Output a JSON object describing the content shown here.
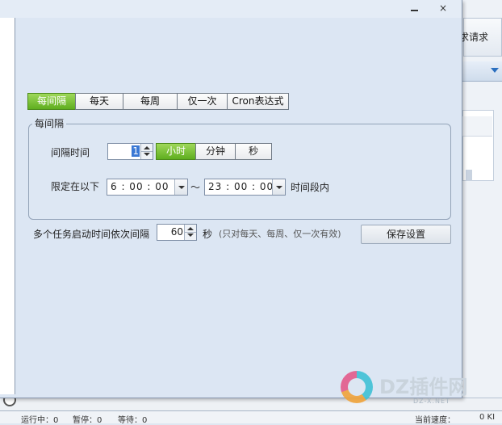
{
  "background": {
    "toolbar_button_label": "求请求",
    "status": {
      "running": "运行中：0",
      "paused": "暂停：0",
      "waiting": "等待：0",
      "speed": "当前速度：",
      "speed_value": "0 KI"
    }
  },
  "dialog": {
    "controls": {
      "minimize": "—",
      "close": "×"
    },
    "tabs": [
      {
        "label": "每间隔",
        "active": true
      },
      {
        "label": "每天",
        "active": false
      },
      {
        "label": "每周",
        "active": false
      },
      {
        "label": "仅一次",
        "active": false
      },
      {
        "label": "Cron表达式",
        "active": false
      }
    ],
    "group_title": "每间隔",
    "interval": {
      "label": "间隔时间",
      "value": "1",
      "units": [
        {
          "label": "小时",
          "active": true
        },
        {
          "label": "分钟",
          "active": false
        },
        {
          "label": "秒",
          "active": false
        }
      ]
    },
    "limit": {
      "label": "限定在以下",
      "start": "6 : 00 : 00",
      "separator": "～",
      "end": "23 : 00 : 00",
      "suffix": "时间段内"
    },
    "multi_task": {
      "label": "多个任务启动时间依次间隔",
      "value": "60",
      "unit": "秒",
      "note": "(只对每天、每周、仅一次有效)"
    },
    "save_button": "保存设置"
  },
  "watermark": {
    "brand": "DZ插件网",
    "sub": "DZ-X.NET"
  }
}
